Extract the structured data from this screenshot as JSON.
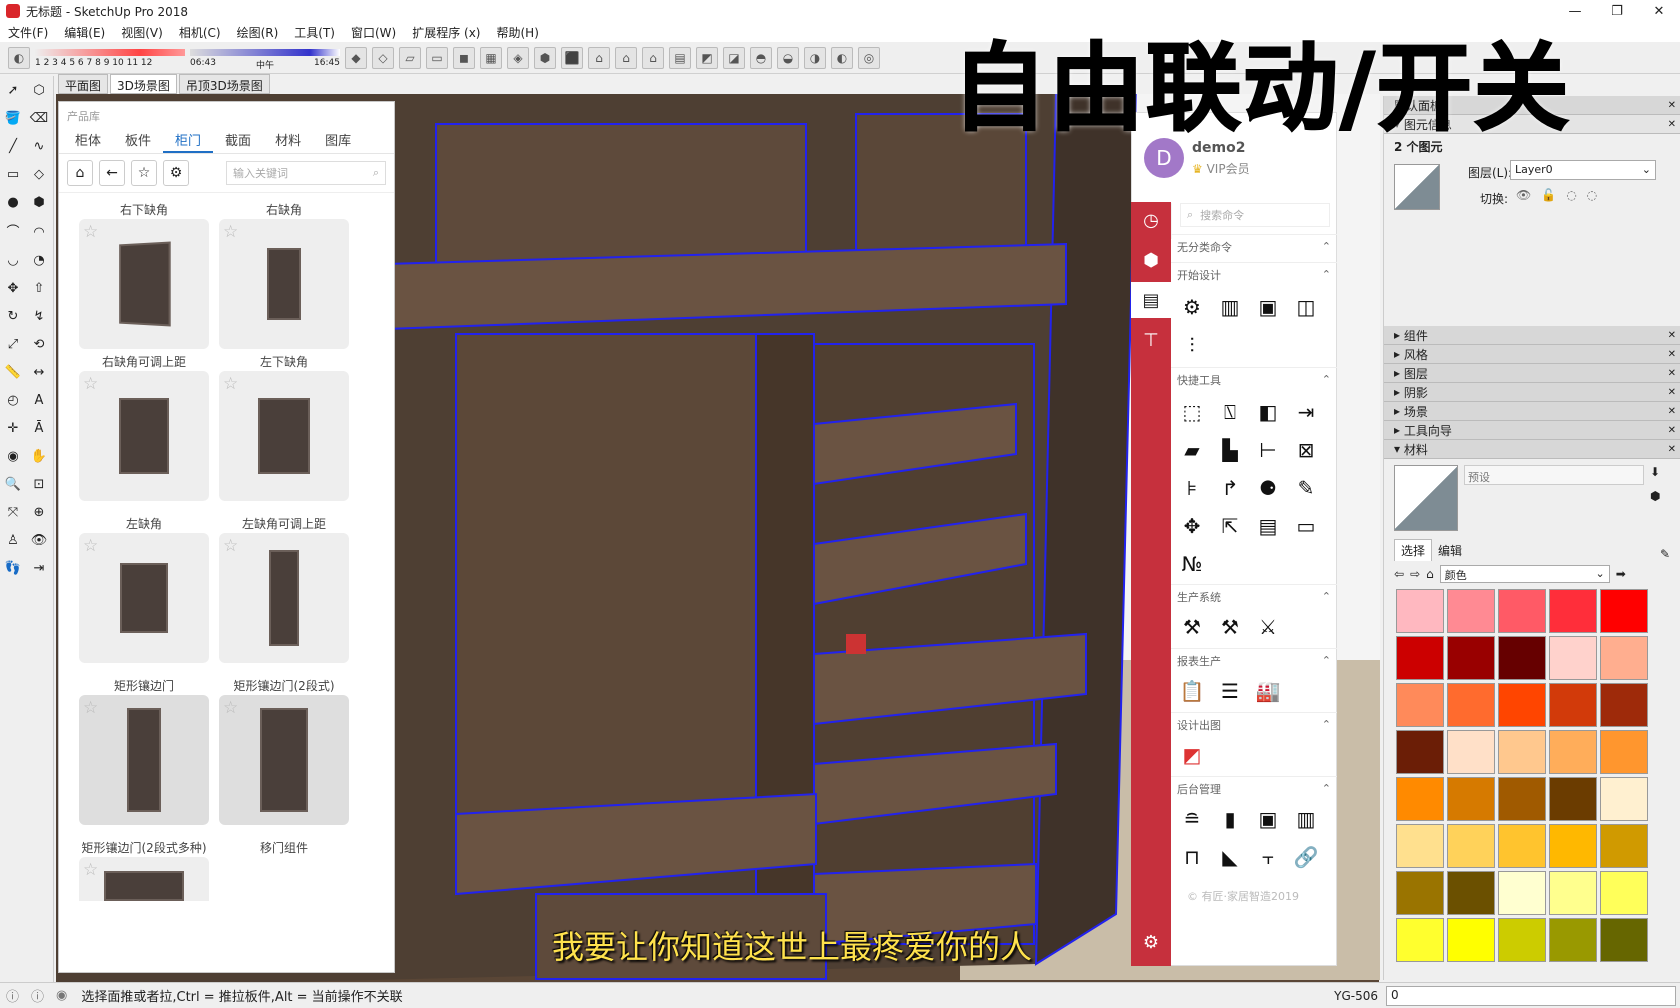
{
  "window": {
    "title": "无标题 - SketchUp Pro 2018",
    "minimize": "—",
    "restore": "❐",
    "close": "✕"
  },
  "menu": [
    "文件(F)",
    "编辑(E)",
    "视图(V)",
    "相机(C)",
    "绘图(R)",
    "工具(T)",
    "窗口(W)",
    "扩展程序 (x)",
    "帮助(H)"
  ],
  "toolbar": {
    "months": "1 2 3 4 5 6 7 8 9 10 11 12",
    "time_start": "06:43",
    "time_mid": "中午",
    "time_end": "16:45"
  },
  "scene_tabs": [
    {
      "label": "平面图"
    },
    {
      "label": "3D场景图",
      "active": true
    },
    {
      "label": "吊顶3D场景图"
    }
  ],
  "library": {
    "header": "产品库",
    "tabs": [
      "柜体",
      "板件",
      "柜门",
      "截面",
      "材料",
      "图库"
    ],
    "active_tab": "柜门",
    "search_placeholder": "输入关键词",
    "top_labels": [
      "右下缺角",
      "右缺角"
    ],
    "items": [
      "右缺角可调上距",
      "左下缺角",
      "左缺角",
      "左缺角可调上距",
      "矩形镶边门",
      "矩形镶边门(2段式)",
      "矩形镶边门(2段式多种)",
      "移门组件"
    ]
  },
  "plugin": {
    "user": "demo2",
    "vip": "VIP会员",
    "avatar_letter": "D",
    "search_placeholder": "搜索命令",
    "sections": {
      "s1": "无分类命令",
      "s2": "开始设计",
      "s3": "快捷工具",
      "s4": "生产系统",
      "s5": "报表生产",
      "s6": "设计出图",
      "s7": "后台管理"
    },
    "footer": "© 有匠·家居智造2019"
  },
  "right_panel": {
    "default_tray": "默认面板",
    "entity_info": "图元信息",
    "count": "2 个图元",
    "layer_label": "图层(L):",
    "layer_value": "Layer0",
    "toggle_label": "切换:",
    "trays": [
      "组件",
      "风格",
      "图层",
      "阴影",
      "场景",
      "工具向导"
    ],
    "materials": "材料",
    "mat_default": "预设",
    "select_tab": "选择",
    "edit_tab": "编辑",
    "color_dropdown": "颜色",
    "swatches": [
      "#ffb8c0",
      "#ff8a93",
      "#ff5a66",
      "#ff2e3a",
      "#ff0000",
      "#cc0000",
      "#990000",
      "#660000",
      "#ffd2cc",
      "#ffae8f",
      "#ff8a5a",
      "#ff6b2e",
      "#ff4500",
      "#d23a0a",
      "#9e2a0a",
      "#6b1e06",
      "#ffe0c8",
      "#ffc88e",
      "#ffad5a",
      "#ff962e",
      "#ff8a00",
      "#d67a00",
      "#a05a00",
      "#6b3c00",
      "#fff0d0",
      "#ffe08e",
      "#ffd25a",
      "#ffc42e",
      "#ffb800",
      "#d09a00",
      "#9a7400",
      "#6b5000",
      "#ffffd0",
      "#ffff8e",
      "#ffff5a",
      "#ffff2e",
      "#ffff00",
      "#cccc00",
      "#999900",
      "#666600"
    ]
  },
  "overlay": {
    "title": "自由联动/开关",
    "subtitle": "我要让你知道这世上最疼爱你的人"
  },
  "status": {
    "text": "选择面推或者拉,Ctrl = 推拉板件,Alt = 当前操作不关联",
    "measure_label": "YG-506",
    "measure_value": "0"
  }
}
